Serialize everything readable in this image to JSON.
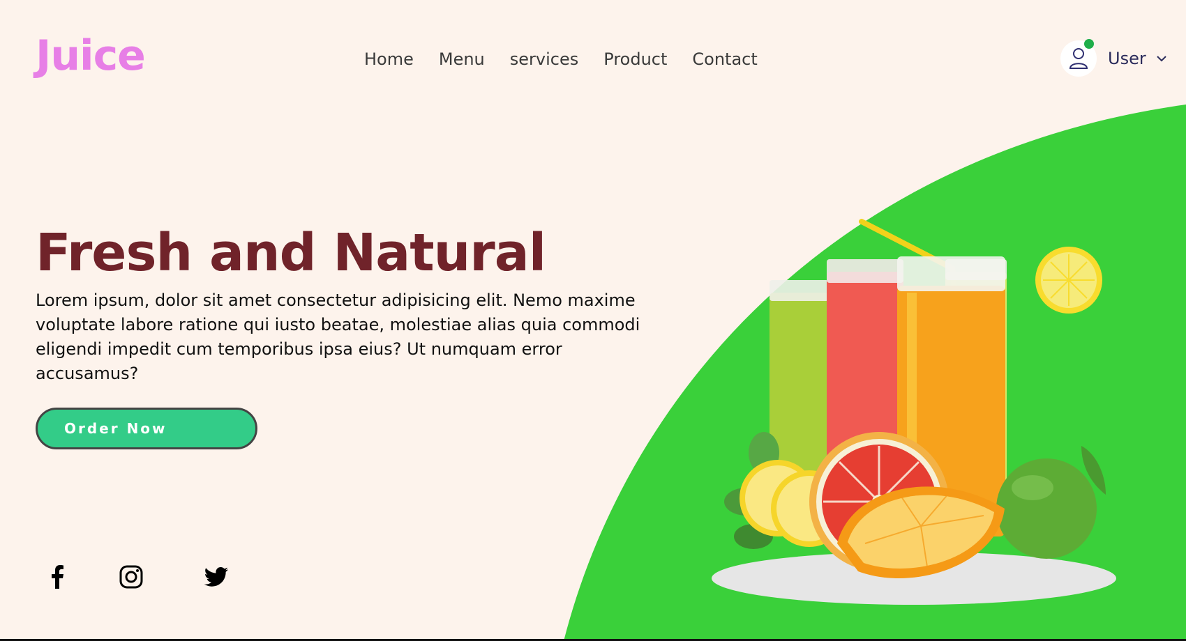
{
  "brand": {
    "name": "Juice",
    "color": "#e77fe6"
  },
  "nav": {
    "items": [
      {
        "label": "Home"
      },
      {
        "label": "Menu"
      },
      {
        "label": "services"
      },
      {
        "label": "Product"
      },
      {
        "label": "Contact"
      }
    ]
  },
  "user": {
    "label": "User",
    "status_color": "#1fae4a",
    "icon": "user-icon",
    "dropdown_icon": "chevron-down-icon"
  },
  "hero": {
    "title": "Fresh and Natural",
    "title_color": "#70232a",
    "description": "Lorem ipsum, dolor sit amet consectetur adipisicing elit. Nemo maxime voluptate labore ratione qui iusto beatae, molestiae alias quia commodi eligendi impedit cum temporibus ipsa eius? Ut numquam error accusamus?",
    "cta_label": "Order Now",
    "cta_color": "#33cc88",
    "accent_green": "#3ad03a"
  },
  "social": [
    {
      "icon": "facebook-icon"
    },
    {
      "icon": "instagram-icon"
    },
    {
      "icon": "twitter-icon"
    }
  ]
}
